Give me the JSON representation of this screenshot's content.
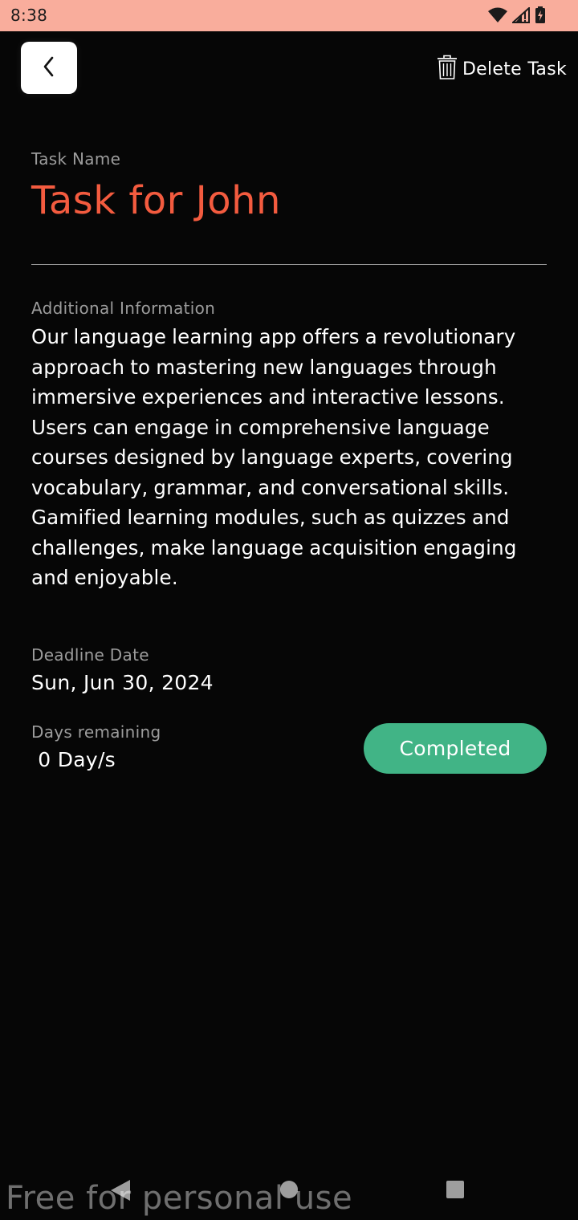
{
  "status_bar": {
    "time": "8:38",
    "background": "#f9ad9c",
    "icons": [
      "wifi-icon",
      "signal-icon",
      "battery-icon"
    ]
  },
  "header": {
    "back_icon": "chevron-left-icon",
    "delete_icon": "trash-icon",
    "delete_label": "Delete Task"
  },
  "task": {
    "name_label": "Task Name",
    "name": "Task for John",
    "info_label": "Additional Information",
    "info": "Our language learning app offers a revolutionary approach to mastering new languages through immersive experiences and interactive lessons. Users can engage in comprehensive language courses designed by language experts, covering vocabulary, grammar, and conversational skills. Gamified learning modules, such as quizzes and challenges, make language acquisition engaging and enjoyable.",
    "deadline_label": "Deadline Date",
    "deadline": "Sun, Jun 30, 2024",
    "days_label": "Days remaining",
    "days_value": " 0 Day/s",
    "status_label": "Completed"
  },
  "colors": {
    "accent_title": "#f35b3f",
    "status_completed": "#41b486",
    "background": "#060606"
  },
  "navigation": {
    "icons": [
      "nav-back-icon",
      "nav-home-icon",
      "nav-recents-icon"
    ]
  },
  "watermark": "Free for personal use"
}
